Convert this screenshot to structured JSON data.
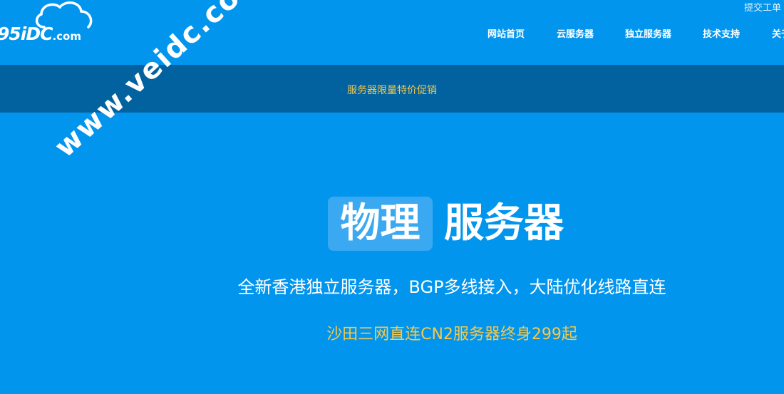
{
  "header": {
    "logo_text": "95iDC",
    "logo_suffix": ".com",
    "ticket_link": "提交工单"
  },
  "nav": {
    "items": [
      {
        "label": "网站首页"
      },
      {
        "label": "云服务器"
      },
      {
        "label": "独立服务器"
      },
      {
        "label": "技术支持"
      },
      {
        "label": "关于"
      }
    ]
  },
  "promo": {
    "text": "服务器限量特价促销"
  },
  "hero": {
    "title_highlight": "物理",
    "title_rest": "服务器",
    "subtitle": "全新香港独立服务器，BGP多线接入，大陆优化线路直连",
    "offer": "沙田三网直连CN2服务器终身299起"
  },
  "watermark": {
    "text": "www.veidc.com"
  },
  "colors": {
    "background": "#0295ee",
    "promo_bar": "#02629f",
    "accent_gold": "#f7c84a",
    "title_box": "#3aa9f2"
  }
}
